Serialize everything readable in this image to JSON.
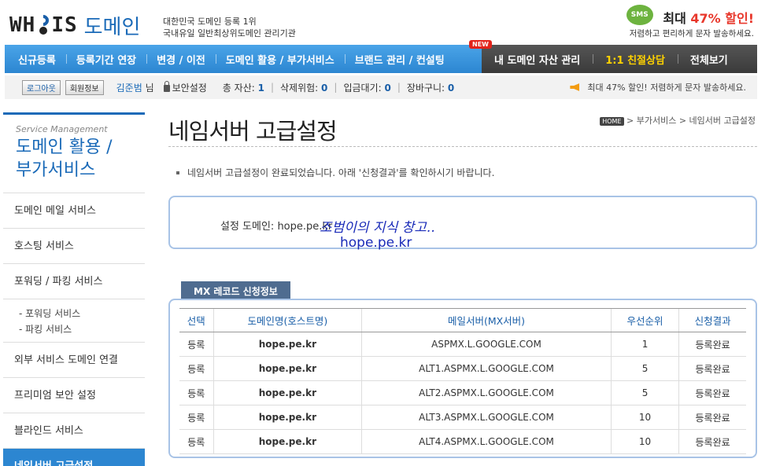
{
  "brand": {
    "logo_text": "WH?IS",
    "logo_domain": "도메인",
    "tagline1": "대한민국 도메인 등록 1위",
    "tagline2": "국내유일 일반최상위도메인 관리기관"
  },
  "promo": {
    "badge": "SMS",
    "prefix": "최대 ",
    "percent": "47% 할인!",
    "sub": "저렴하고 편리하게 문자 발송하세요."
  },
  "nav": {
    "blue_items": [
      "신규등록",
      "등록기간 연장",
      "변경 / 이전",
      "도메인 활용 / 부가서비스",
      "브랜드 관리 / 컨설팅"
    ],
    "new_badge": "NEW",
    "dark_items": [
      "내 도메인 자산 관리",
      "1:1 친절상담",
      "전체보기"
    ]
  },
  "userbar": {
    "logout": "로그아웃",
    "member_info": "회원정보",
    "user": "김준범",
    "honorific": "님",
    "security": "보안설정",
    "assets_label": "총 자산: ",
    "assets": "1",
    "delete_label": "삭제위험: ",
    "delete": "0",
    "pay_label": "입금대기: ",
    "pay": "0",
    "cart_label": "장바구니: ",
    "cart": "0",
    "notice": "최대 47% 할인! 저렴하게 문자 발송하세요."
  },
  "sidebar": {
    "sub": "Service Management",
    "title1": "도메인 활용 /",
    "title2": "부가서비스",
    "items": [
      "도메인 메일 서비스",
      "호스팅 서비스",
      "포워딩 / 파킹 서비스"
    ],
    "subitems": [
      "- 포워딩 서비스",
      "- 파킹 서비스"
    ],
    "items2": [
      "외부 서비스 도메인 연결",
      "프리미엄 보안 설정",
      "블라인드 서비스",
      "네임서버 고급설정"
    ]
  },
  "page": {
    "title": "네임서버 고급설정",
    "breadcrumb_home": "HOME",
    "breadcrumb": " > 부가서비스 > 네임서버 고급설정",
    "message": "네임서버 고급설정이 완료되었습니다. 아래 '신청결과'를 확인하시기 바랍니다.",
    "domain_label": "설정 도메인: hope.pe.kr",
    "annotation1": "조범이의 지식 창고..",
    "annotation2": "hope.pe.kr",
    "tab": "MX 레코드 신청정보"
  },
  "mx_table": {
    "headers": [
      "선택",
      "도메인명(호스트명)",
      "메일서버(MX서버)",
      "우선순위",
      "신청결과"
    ],
    "rows": [
      [
        "등록",
        "hope.pe.kr",
        "ASPMX.L.GOOGLE.COM",
        "1",
        "등록완료"
      ],
      [
        "등록",
        "hope.pe.kr",
        "ALT1.ASPMX.L.GOOGLE.COM",
        "5",
        "등록완료"
      ],
      [
        "등록",
        "hope.pe.kr",
        "ALT2.ASPMX.L.GOOGLE.COM",
        "5",
        "등록완료"
      ],
      [
        "등록",
        "hope.pe.kr",
        "ALT3.ASPMX.L.GOOGLE.COM",
        "10",
        "등록완료"
      ],
      [
        "등록",
        "hope.pe.kr",
        "ALT4.ASPMX.L.GOOGLE.COM",
        "10",
        "등록완료"
      ]
    ]
  }
}
